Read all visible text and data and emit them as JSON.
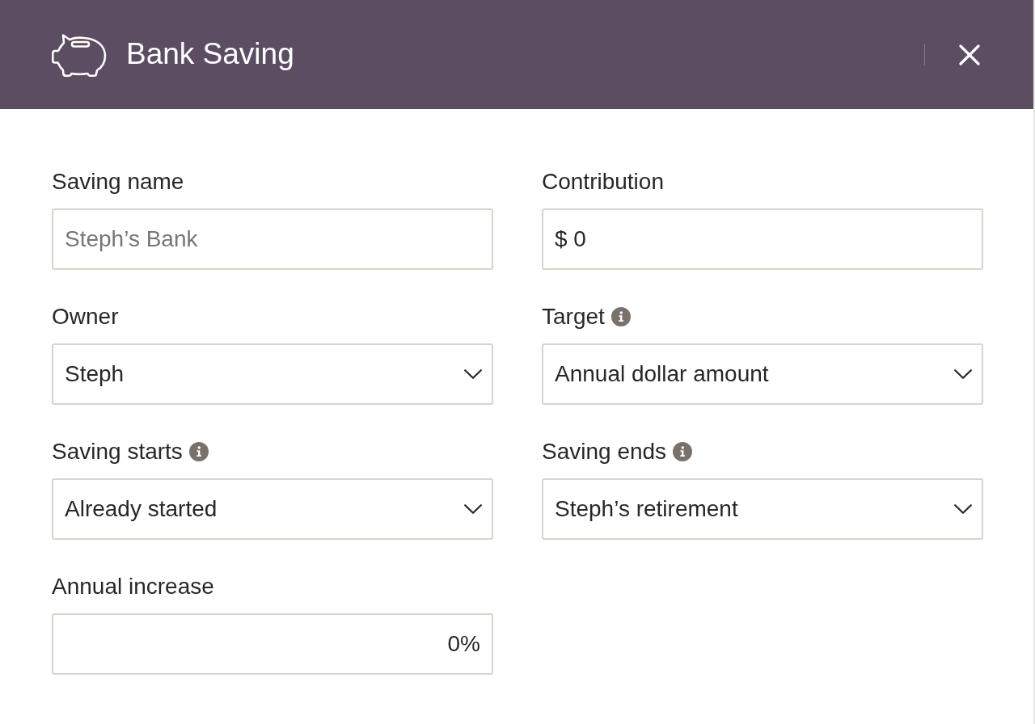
{
  "header": {
    "title": "Bank Saving"
  },
  "fields": [
    {
      "label": "Saving name",
      "info": false,
      "kind": "text",
      "placeholder": "Steph’s Bank"
    },
    {
      "label": "Contribution",
      "info": false,
      "kind": "text",
      "value": "$ 0"
    },
    {
      "label": "Owner",
      "info": false,
      "kind": "select",
      "value": "Steph"
    },
    {
      "label": "Target",
      "info": true,
      "kind": "select",
      "value": "Annual dollar amount"
    },
    {
      "label": "Saving starts",
      "info": true,
      "kind": "select",
      "value": "Already started"
    },
    {
      "label": "Saving ends",
      "info": true,
      "kind": "select",
      "value": "Steph’s retirement"
    },
    {
      "label": "Annual increase",
      "info": false,
      "kind": "percent",
      "value": "0%"
    }
  ]
}
